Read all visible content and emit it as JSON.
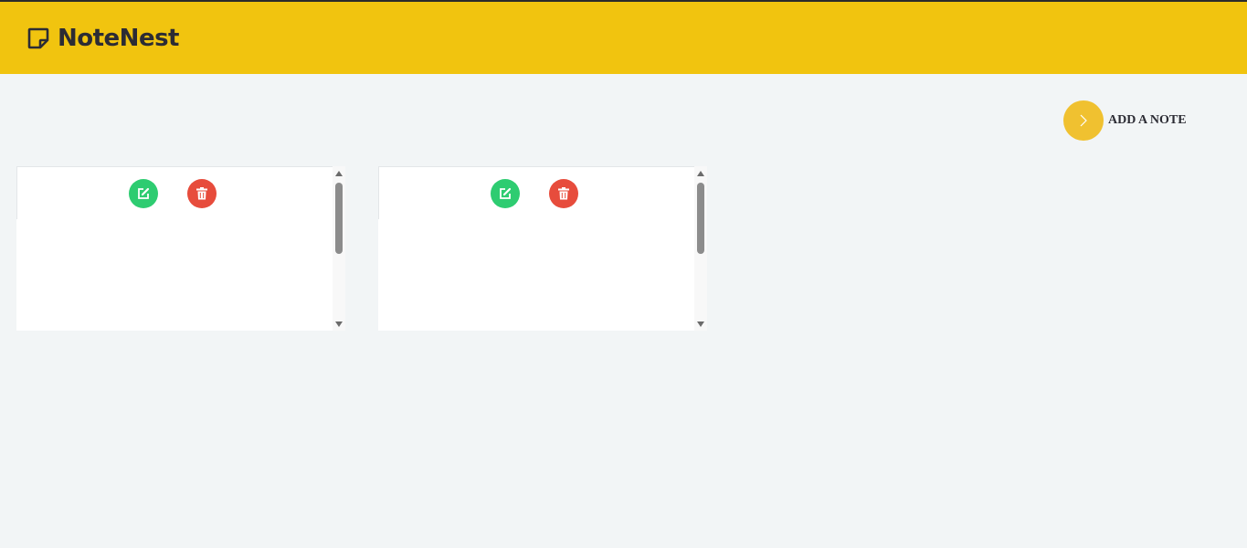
{
  "app": {
    "name": "NoteNest",
    "brand_icon": "sticky-note-icon",
    "accent_color": "#f1c40f"
  },
  "actions": {
    "add_note_label": "ADD A NOTE",
    "add_note_icon": "chevron-right-icon"
  },
  "notes": [
    {
      "edit_icon": "edit-icon",
      "delete_icon": "trash-icon",
      "text": ""
    },
    {
      "edit_icon": "edit-icon",
      "delete_icon": "trash-icon",
      "text": ""
    }
  ],
  "colors": {
    "edit": "#2ecc71",
    "delete": "#e74c3c"
  }
}
